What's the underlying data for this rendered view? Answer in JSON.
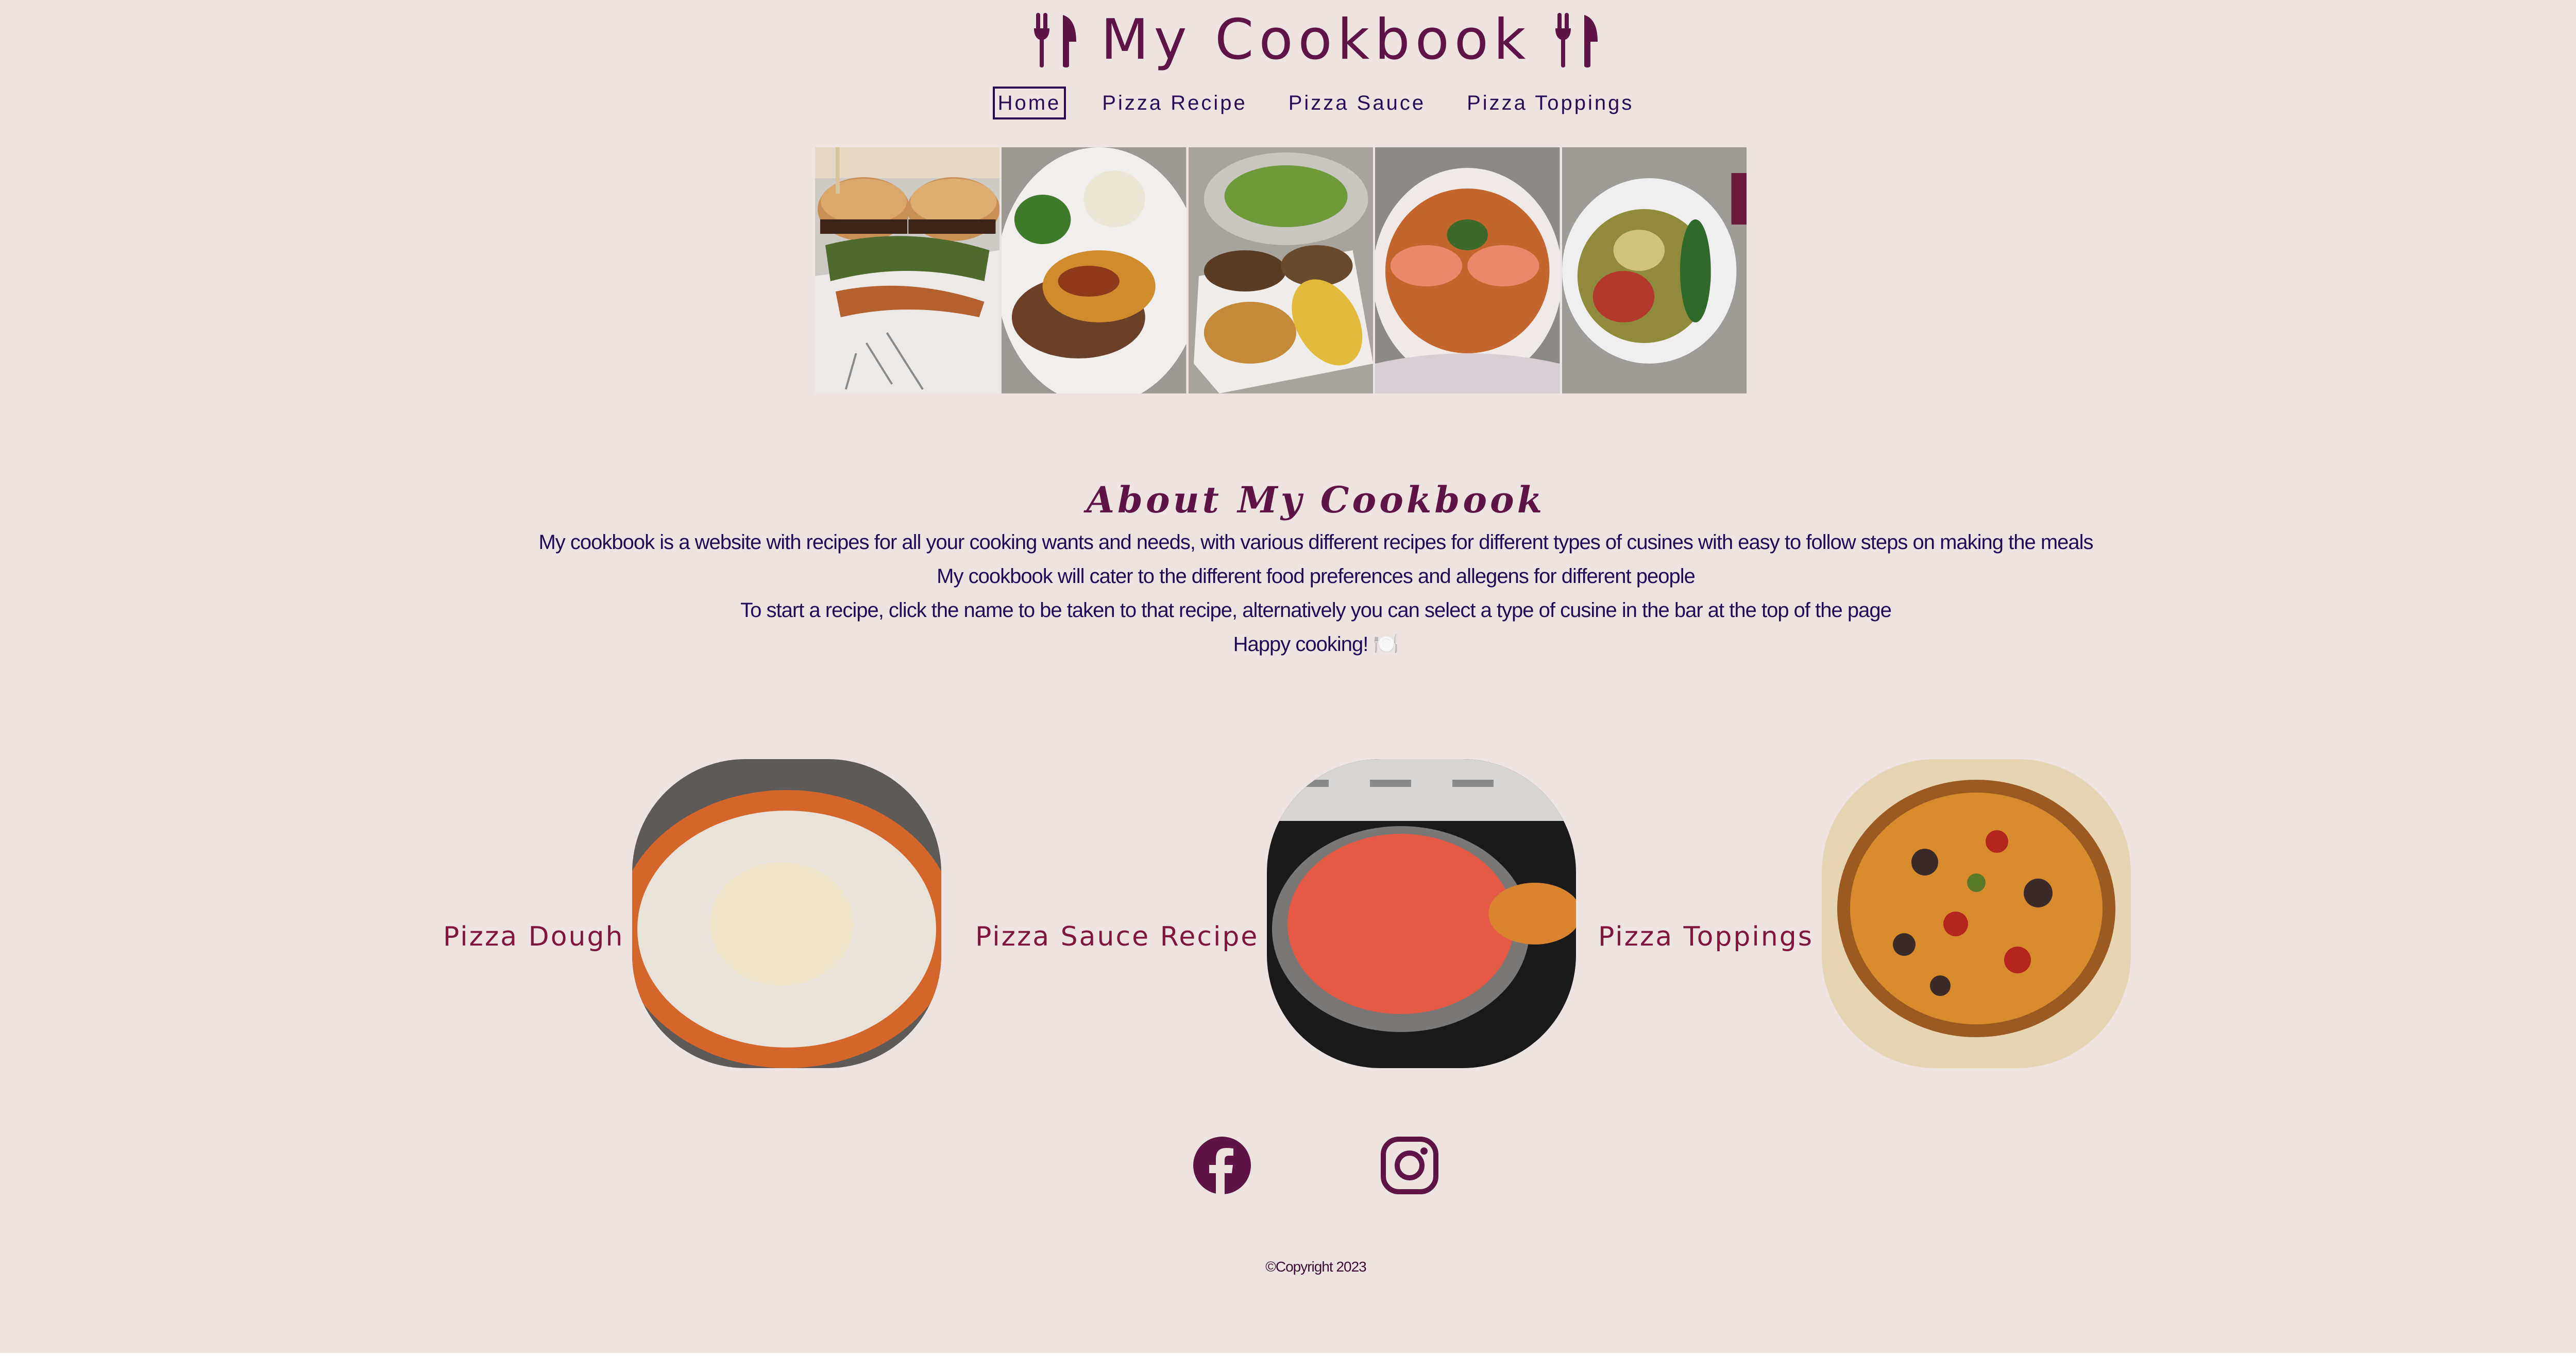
{
  "header": {
    "title": "My Cookbook",
    "left_icon": "utensils-icon",
    "right_icon": "utensils-icon",
    "brand_color": "#5f1446"
  },
  "nav": {
    "items": [
      {
        "label": "Home",
        "active": true
      },
      {
        "label": "Pizza Recipe",
        "active": false
      },
      {
        "label": "Pizza Sauce",
        "active": false
      },
      {
        "label": "Pizza Toppings",
        "active": false
      }
    ]
  },
  "gallery": {
    "photos": [
      "burgers-and-prawns-photo",
      "chicken-and-vegetables-photo",
      "tacos-and-corn-photo",
      "langoustine-pasta-photo",
      "salad-bowl-photo"
    ]
  },
  "about": {
    "title": "About My Cookbook",
    "lines": [
      "My cookbook is a website with recipes for all your cooking wants and needs, with various different recipes for different types of cusines with easy to follow steps on making the meals",
      "My cookbook will cater to the different food preferences and allegens for different people",
      "To start a recipe, click the name to be taken to that recipe, alternatively you can select a type of cusine in the bar at the top of the page",
      "Happy cooking! 🍽️"
    ]
  },
  "recipes": [
    {
      "label": "Pizza Dough",
      "photo": "pizza-dough-photo"
    },
    {
      "label": "Pizza Sauce Recipe",
      "photo": "pizza-sauce-photo"
    },
    {
      "label": "Pizza Toppings",
      "photo": "pizza-toppings-photo"
    }
  ],
  "social": {
    "icons": [
      "facebook-icon",
      "instagram-icon"
    ]
  },
  "footer": {
    "copyright": "©Copyright 2023"
  }
}
